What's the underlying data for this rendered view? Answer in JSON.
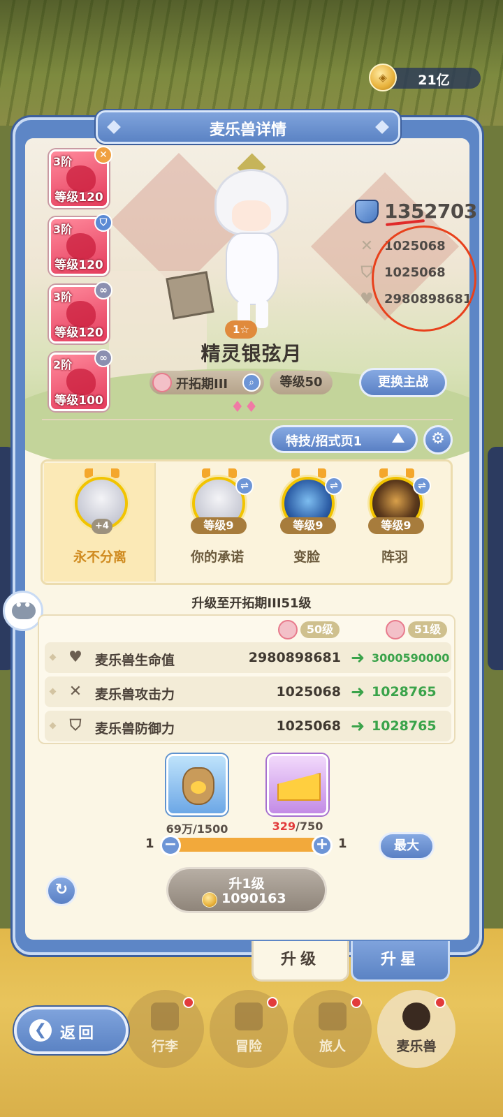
{
  "currency": {
    "icon": "gold-coin-icon",
    "amount": "21亿"
  },
  "panel": {
    "title": "麦乐兽详情"
  },
  "side_cards": [
    {
      "tier": "3阶",
      "level": "等级120",
      "badge_color": "#f0a040",
      "badge_icon": "cross-swords-icon",
      "badge_glyph": "✕"
    },
    {
      "tier": "3阶",
      "level": "等级120",
      "badge_color": "#5b8ad4",
      "badge_icon": "shield-icon",
      "badge_glyph": "⛉"
    },
    {
      "tier": "3阶",
      "level": "等级120",
      "badge_color": "#8b8fb0",
      "badge_icon": "link-icon",
      "badge_glyph": "∞"
    },
    {
      "tier": "2阶",
      "level": "等级100",
      "badge_color": "#8b8fb0",
      "badge_icon": "link-icon",
      "badge_glyph": "∞"
    }
  ],
  "character": {
    "name": "精灵银弦月",
    "star_badge": "1☆",
    "period": "开拓期III",
    "level": "等级50",
    "swap_button": "更换主战"
  },
  "stats": {
    "power": "1352703",
    "attack": "1025068",
    "defense": "1025068",
    "hp": "2980898681"
  },
  "skills_page": {
    "label": "特技/招式页1"
  },
  "skills": [
    {
      "name": "永不分离",
      "tag": "+4",
      "style": "white"
    },
    {
      "name": "你的承诺",
      "level": "等级9",
      "style": "white"
    },
    {
      "name": "变脸",
      "level": "等级9",
      "style": "blue"
    },
    {
      "name": "阵羽",
      "level": "等级9",
      "style": "dark"
    }
  ],
  "upgrade": {
    "title": "升级至开拓期III51级",
    "from_level": "50级",
    "to_level": "51级",
    "rows": [
      {
        "label": "麦乐兽生命值",
        "icon": "heart-icon",
        "glyph": "♥",
        "current": "2980898681",
        "next": "3000590000"
      },
      {
        "label": "麦乐兽攻击力",
        "icon": "crossed-swords-icon",
        "glyph": "✕",
        "current": "1025068",
        "next": "1028765"
      },
      {
        "label": "麦乐兽防御力",
        "icon": "shield-icon",
        "glyph": "⛉",
        "current": "1025068",
        "next": "1028765"
      }
    ],
    "items": [
      {
        "name": "food-bag-icon",
        "have": "69万",
        "need": "/1500"
      },
      {
        "name": "cheese-icon",
        "have": "329",
        "need": "/750"
      }
    ],
    "qty_min": "1",
    "qty_max": "1",
    "max_button": "最大",
    "level_up_button": "升1级",
    "cost": "1090163"
  },
  "tabs": {
    "upgrade": "升级",
    "star_up": "升星"
  },
  "nav": {
    "back": "返回",
    "items": [
      "行李",
      "冒险",
      "旅人",
      "麦乐兽"
    ]
  }
}
